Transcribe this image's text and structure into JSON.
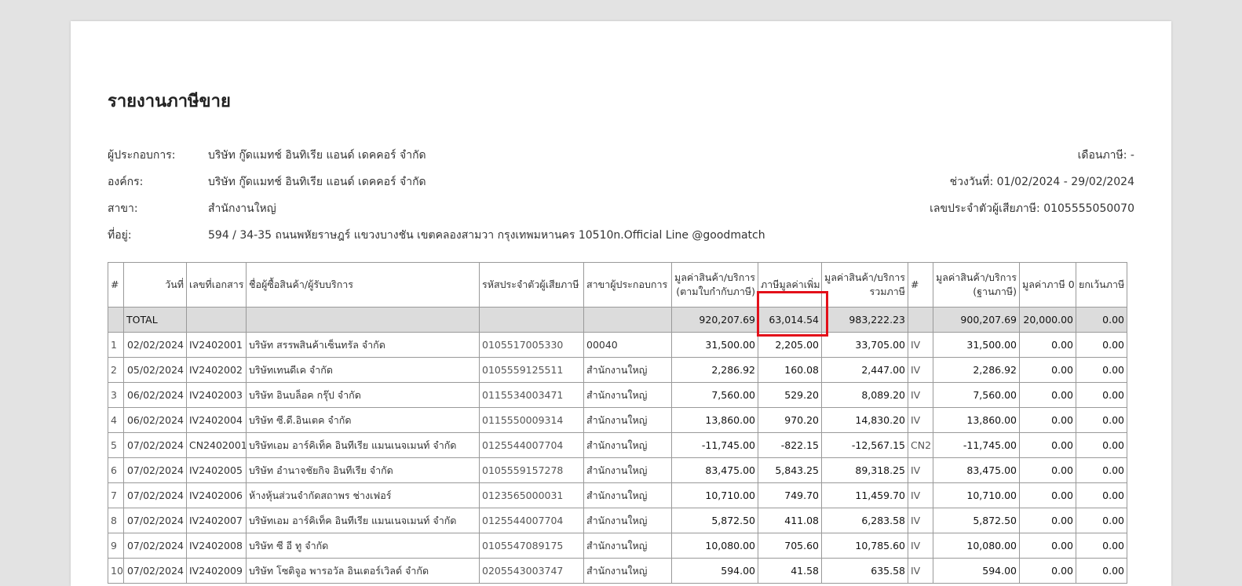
{
  "title": "รายงานภาษีขาย",
  "info_left": [
    {
      "label": "ผู้ประกอบการ:",
      "value": "บริษัท กู๊ดแมทช์ อินทิเรีย แอนด์ เดคคอร์ จำกัด"
    },
    {
      "label": "องค์กร:",
      "value": "บริษัท กู๊ดแมทช์ อินทิเรีย แอนด์ เดคคอร์ จำกัด"
    },
    {
      "label": "สาขา:",
      "value": "สำนักงานใหญ่"
    },
    {
      "label": "ที่อยู่:",
      "value": "594 / 34-35 ถนนพหัยราษฎร์ แขวงบางชัน เขตคลองสามวา กรุงเทพมหานคร 10510n.Official Line @goodmatch"
    }
  ],
  "info_right": [
    "เดือนภาษี: -",
    "ช่วงวันที่: 01/02/2024 - 29/02/2024",
    "เลขประจำตัวผู้เสียภาษี: 0105555050070"
  ],
  "headers": {
    "no": "#",
    "date": "วันที่",
    "doc": "เลขที่เอกสาร",
    "name": "ชื่อผู้ซื้อสินค้า/ผู้รับบริการ",
    "taxid": "รหัสประจำตัวผู้เสียภาษี",
    "branch": "สาขาผู้ประกอบการ",
    "amount_1": "มูลค่าสินค้า/บริการ",
    "amount_2": "(ตามใบกำกับภาษี)",
    "vat": "ภาษีมูลค่าเพิ่ม",
    "total_1": "มูลค่าสินค้า/บริการ",
    "total_2": "รวมภาษี",
    "type": "#",
    "base_1": "มูลค่าสินค้า/บริการ",
    "base_2": "(ฐานภาษี)",
    "zero": "มูลค่าภาษี 0",
    "exempt": "ยกเว้นภาษี"
  },
  "total_row": {
    "label": "TOTAL",
    "amount": "920,207.69",
    "vat": "63,014.54",
    "total": "983,222.23",
    "base": "900,207.69",
    "zero": "20,000.00",
    "exempt": "0.00"
  },
  "rows": [
    {
      "no": "1",
      "date": "02/02/2024",
      "doc": "IV2402001",
      "name": "บริษัท สรรพสินค้าเซ็นทรัล จำกัด",
      "taxid": "0105517005330",
      "branch": "00040",
      "amount": "31,500.00",
      "vat": "2,205.00",
      "total": "33,705.00",
      "type": "IV",
      "base": "31,500.00",
      "zero": "0.00",
      "exempt": "0.00"
    },
    {
      "no": "2",
      "date": "05/02/2024",
      "doc": "IV2402002",
      "name": "บริษัทเทนดีเค จำกัด",
      "taxid": "0105559125511",
      "branch": "สำนักงานใหญ่",
      "amount": "2,286.92",
      "vat": "160.08",
      "total": "2,447.00",
      "type": "IV",
      "base": "2,286.92",
      "zero": "0.00",
      "exempt": "0.00"
    },
    {
      "no": "3",
      "date": "06/02/2024",
      "doc": "IV2402003",
      "name": "บริษัท อินบล็อค กรุ๊ป จำกัด",
      "taxid": "0115534003471",
      "branch": "สำนักงานใหญ่",
      "amount": "7,560.00",
      "vat": "529.20",
      "total": "8,089.20",
      "type": "IV",
      "base": "7,560.00",
      "zero": "0.00",
      "exempt": "0.00"
    },
    {
      "no": "4",
      "date": "06/02/2024",
      "doc": "IV2402004",
      "name": "บริษัท ซี.ดี.อินเตค จำกัด",
      "taxid": "0115550009314",
      "branch": "สำนักงานใหญ่",
      "amount": "13,860.00",
      "vat": "970.20",
      "total": "14,830.20",
      "type": "IV",
      "base": "13,860.00",
      "zero": "0.00",
      "exempt": "0.00"
    },
    {
      "no": "5",
      "date": "07/02/2024",
      "doc": "CN2402001",
      "name": "บริษัทเอม อาร์คิเท็ค อินทีเรีย แมนเนจเมนท์ จำกัด",
      "taxid": "0125544007704",
      "branch": "สำนักงานใหญ่",
      "amount": "-11,745.00",
      "vat": "-822.15",
      "total": "-12,567.15",
      "type": "CN2",
      "base": "-11,745.00",
      "zero": "0.00",
      "exempt": "0.00"
    },
    {
      "no": "6",
      "date": "07/02/2024",
      "doc": "IV2402005",
      "name": "บริษัท อำนาจชัยกิจ อินทีเรีย จำกัด",
      "taxid": "0105559157278",
      "branch": "สำนักงานใหญ่",
      "amount": "83,475.00",
      "vat": "5,843.25",
      "total": "89,318.25",
      "type": "IV",
      "base": "83,475.00",
      "zero": "0.00",
      "exempt": "0.00"
    },
    {
      "no": "7",
      "date": "07/02/2024",
      "doc": "IV2402006",
      "name": "ห้างหุ้นส่วนจำกัดสถาพร ช่างเฟอร์",
      "taxid": "0123565000031",
      "branch": "สำนักงานใหญ่",
      "amount": "10,710.00",
      "vat": "749.70",
      "total": "11,459.70",
      "type": "IV",
      "base": "10,710.00",
      "zero": "0.00",
      "exempt": "0.00"
    },
    {
      "no": "8",
      "date": "07/02/2024",
      "doc": "IV2402007",
      "name": "บริษัทเอม อาร์คิเท็ค อินทีเรีย แมนเนจเมนท์ จำกัด",
      "taxid": "0125544007704",
      "branch": "สำนักงานใหญ่",
      "amount": "5,872.50",
      "vat": "411.08",
      "total": "6,283.58",
      "type": "IV",
      "base": "5,872.50",
      "zero": "0.00",
      "exempt": "0.00"
    },
    {
      "no": "9",
      "date": "07/02/2024",
      "doc": "IV2402008",
      "name": "บริษัท ซี อี ทู จำกัด",
      "taxid": "0105547089175",
      "branch": "สำนักงานใหญ่",
      "amount": "10,080.00",
      "vat": "705.60",
      "total": "10,785.60",
      "type": "IV",
      "base": "10,080.00",
      "zero": "0.00",
      "exempt": "0.00"
    },
    {
      "no": "10",
      "date": "07/02/2024",
      "doc": "IV2402009",
      "name": "บริษัท โซติจูอ พารอวัล อินเตอร์เวิลด์ จำกัด",
      "taxid": "0205543003747",
      "branch": "สำนักงานใหญ่",
      "amount": "594.00",
      "vat": "41.58",
      "total": "635.58",
      "type": "IV",
      "base": "594.00",
      "zero": "0.00",
      "exempt": "0.00"
    }
  ],
  "colors": {
    "highlight": "#e3101a",
    "total_bg": "#dcdcdc",
    "border": "#999999"
  }
}
